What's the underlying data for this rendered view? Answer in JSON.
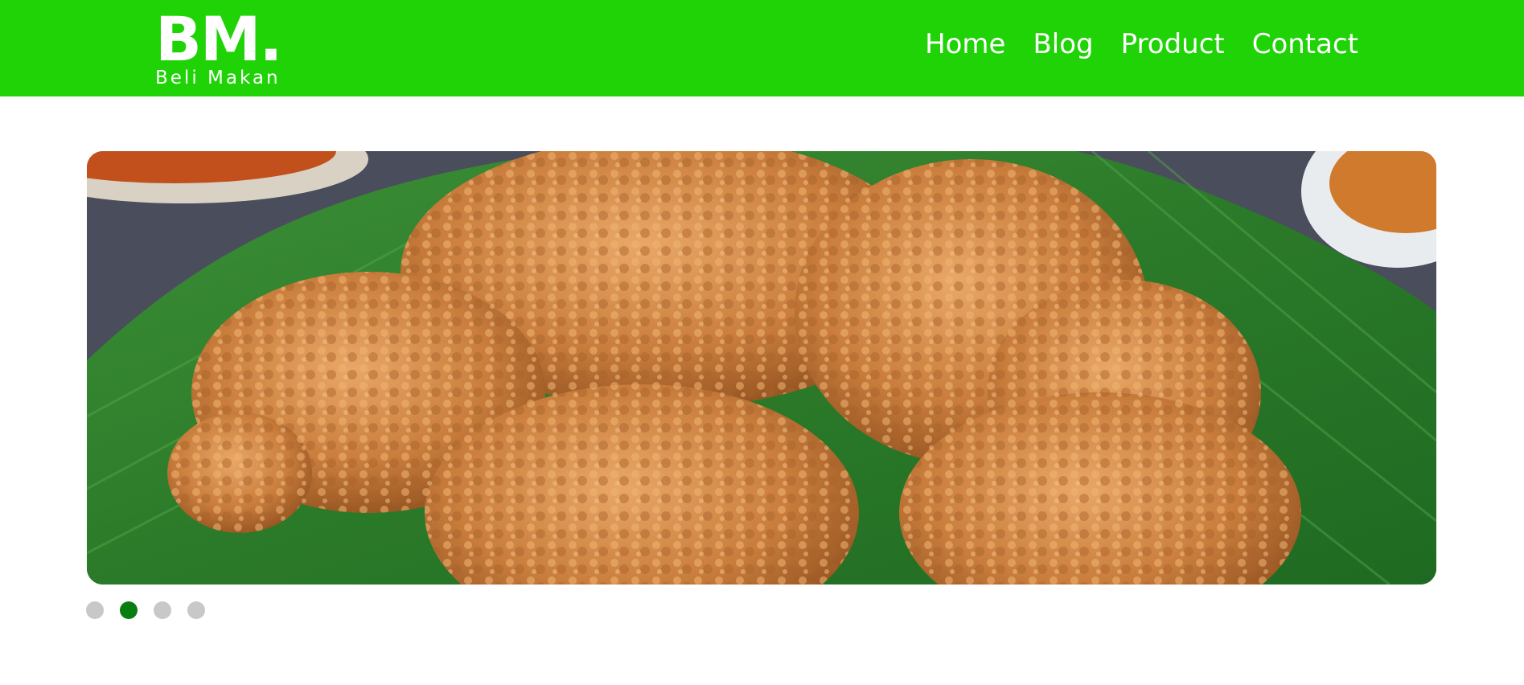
{
  "header": {
    "logo_text": "BM.",
    "logo_subtitle": "Beli Makan",
    "background_color": "#1fd307",
    "nav": [
      {
        "label": "Home"
      },
      {
        "label": "Blog"
      },
      {
        "label": "Product"
      },
      {
        "label": "Contact"
      }
    ]
  },
  "carousel": {
    "slide_image": "fried-chicken-on-banana-leaf",
    "slide_count": 4,
    "active_index": 1,
    "active_dot_color": "#0a7d10",
    "inactive_dot_color": "#c8c8c8"
  }
}
